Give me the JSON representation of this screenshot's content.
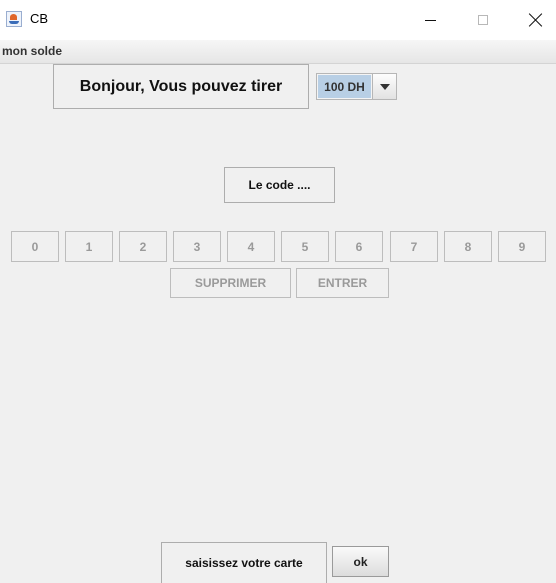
{
  "window": {
    "title": "CB",
    "app_icon": "java-icon",
    "controls": [
      "minimize-icon",
      "maximize-icon",
      "close-icon"
    ]
  },
  "menubar": {
    "items": [
      {
        "label": "mon solde"
      }
    ]
  },
  "greeting": {
    "text": "Bonjour, Vous pouvez tirer"
  },
  "amount": {
    "selected": "100 DH",
    "icon": "chevron-down-icon"
  },
  "code": {
    "label": "Le code ...."
  },
  "keypad": {
    "keys": [
      "0",
      "1",
      "2",
      "3",
      "4",
      "5",
      "6",
      "7",
      "8",
      "9"
    ],
    "delete_label": "SUPPRIMER",
    "enter_label": "ENTRER"
  },
  "card": {
    "prompt": "saisissez votre carte",
    "ok_label": "ok"
  },
  "colors": {
    "background": "#f0f0f0",
    "selection": "#b8cfe5",
    "disabled_text": "#9a9a9a"
  }
}
